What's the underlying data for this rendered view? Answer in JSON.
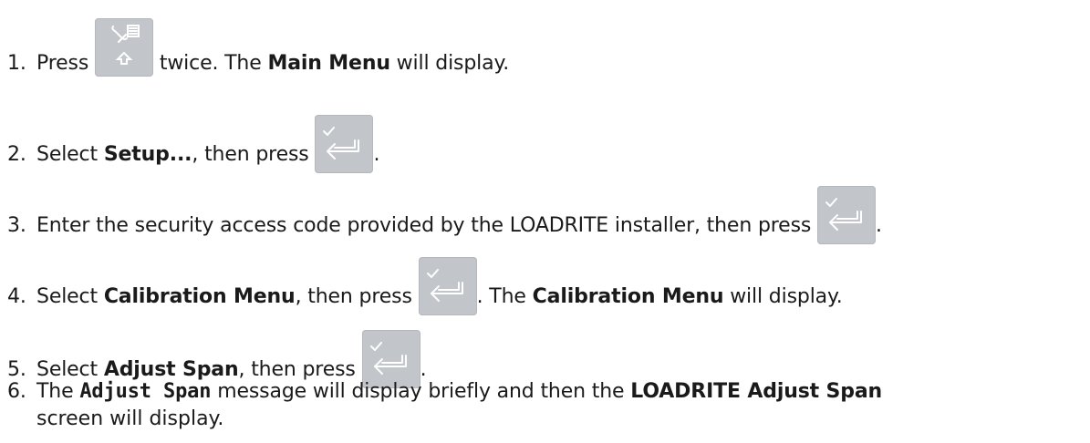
{
  "steps": [
    {
      "num": "1.",
      "before": "Press",
      "key": "settings-shift-key",
      "mid": " twice. The ",
      "bold": "Main Menu",
      "after": " will display."
    },
    {
      "num": "2.",
      "before": "Select ",
      "bold": "Setup...",
      "after": ", then press",
      "key": "enter-key",
      "end": "."
    },
    {
      "num": "3.",
      "before": "Enter the security access code provided by the LOADRITE installer, then press",
      "key": "enter-key",
      "end": "."
    },
    {
      "num": "4.",
      "before": "Select ",
      "bold": "Calibration Menu",
      "after": ", then press",
      "key": "enter-key",
      "mid": ". The ",
      "bold2": "Calibration Menu",
      "end": " will display."
    },
    {
      "num": "5.",
      "before": "Select ",
      "bold": "Adjust Span",
      "after": ", then press",
      "key": "enter-key",
      "end": "."
    },
    {
      "num": "6.",
      "before": "The ",
      "mono": "Adjust Span",
      "after": " message will display briefly and then the ",
      "bold": "LOADRITE Adjust Span",
      "line2": "screen will display."
    }
  ],
  "colors": {
    "key_bg": "#c2c6cb",
    "key_glyph": "#ffffff",
    "text": "#1a1a1a"
  }
}
